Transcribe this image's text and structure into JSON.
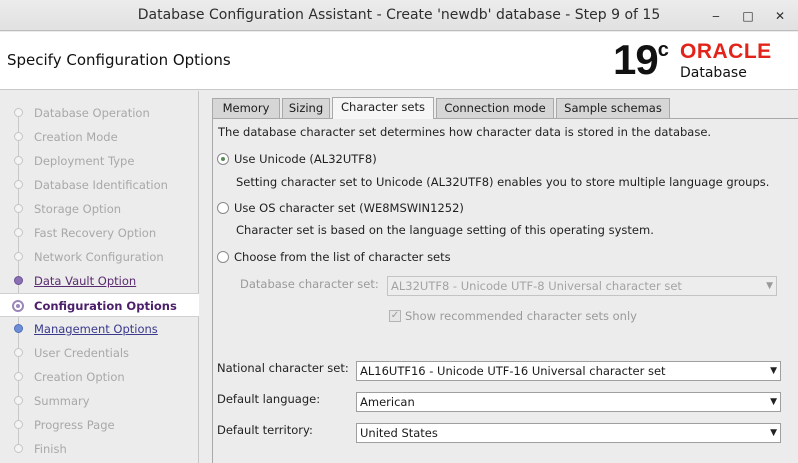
{
  "window": {
    "title": "Database Configuration Assistant - Create 'newdb' database - Step 9 of 15",
    "minimize_glyph": "‒",
    "maximize_glyph": "□",
    "close_glyph": "✕"
  },
  "header": {
    "page_title": "Specify Configuration Options",
    "logo_version": "19",
    "logo_version_sup": "c",
    "logo_brand": "ORACLE",
    "logo_product": "Database",
    "brand_color": "#e2231a"
  },
  "sidebar": {
    "items": [
      {
        "label": "Database Operation",
        "state": "done"
      },
      {
        "label": "Creation Mode",
        "state": "done"
      },
      {
        "label": "Deployment Type",
        "state": "done"
      },
      {
        "label": "Database Identification",
        "state": "done"
      },
      {
        "label": "Storage Option",
        "state": "done"
      },
      {
        "label": "Fast Recovery Option",
        "state": "done"
      },
      {
        "label": "Network Configuration",
        "state": "done"
      },
      {
        "label": "Data Vault Option",
        "state": "link"
      },
      {
        "label": "Configuration Options",
        "state": "active"
      },
      {
        "label": "Management Options",
        "state": "link"
      },
      {
        "label": "User Credentials",
        "state": "pending"
      },
      {
        "label": "Creation Option",
        "state": "pending"
      },
      {
        "label": "Summary",
        "state": "pending"
      },
      {
        "label": "Progress Page",
        "state": "pending"
      },
      {
        "label": "Finish",
        "state": "pending"
      }
    ]
  },
  "tabs": [
    {
      "label": "Memory"
    },
    {
      "label": "Sizing"
    },
    {
      "label": "Character sets",
      "active": true
    },
    {
      "label": "Connection mode"
    },
    {
      "label": "Sample schemas"
    }
  ],
  "charset": {
    "intro": "The database character set determines how character data is stored in the database.",
    "opt_unicode": "Use Unicode (AL32UTF8)",
    "opt_unicode_desc": "Setting character set to Unicode (AL32UTF8) enables you to store multiple language groups.",
    "opt_os": "Use OS character set (WE8MSWIN1252)",
    "opt_os_desc": "Character set is based on the language setting of this operating system.",
    "opt_list": "Choose from the list of character sets",
    "db_charset_label": "Database character set:",
    "db_charset_value": "AL32UTF8 - Unicode UTF-8 Universal character set",
    "show_recommended": "Show recommended character sets only",
    "show_recommended_checked": true,
    "selected_option": "unicode",
    "national_label": "National character set:",
    "national_value": "AL16UTF16 - Unicode UTF-16 Universal character set",
    "language_label": "Default language:",
    "language_value": "American",
    "territory_label": "Default territory:",
    "territory_value": "United States"
  }
}
